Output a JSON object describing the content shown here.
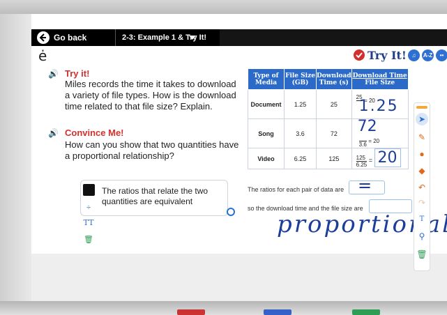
{
  "topbar": {
    "back_label": "Go back",
    "lesson_title": "2-3: Example 1 & Try It!"
  },
  "header": {
    "logo": "ė",
    "try_it_label": "Try It!",
    "az_label": "A-Z"
  },
  "problem": {
    "try_heading": "Try it!",
    "try_text": "Miles records the time it takes to download a variety of file types. How is the download time related to that file size? Explain.",
    "convince_heading": "Convince Me!",
    "convince_text": "How can you show that two quantities have a proportional relationship?"
  },
  "answer_card": {
    "text": "The ratios that relate the two quantities are equivalent",
    "font_tool": "TT"
  },
  "table": {
    "headers": [
      "Type of Media",
      "File Size (GB)",
      "Download Time (s)",
      "Download Time",
      "File Size"
    ],
    "rows": [
      {
        "media": "Document",
        "size": "1.25",
        "time": "25",
        "num": "25",
        "den": "1.25",
        "result": "20",
        "handwritten": "1.25"
      },
      {
        "media": "Song",
        "size": "3.6",
        "time": "72",
        "num": "72",
        "den": "3.6",
        "result": "20",
        "handwritten": "72"
      },
      {
        "media": "Video",
        "size": "6.25",
        "time": "125",
        "num": "125",
        "den": "6.25",
        "result": "20",
        "handwritten": "20"
      }
    ]
  },
  "sentences": {
    "line1": "The ratios for each pair of data are",
    "blank1": "=",
    "line2": "so the download time and the file size are",
    "handwriting": "proportional"
  },
  "colors": {
    "accent": "#2b6ac9",
    "heading_red": "#d32f2f",
    "ink": "#1c3e9a"
  }
}
